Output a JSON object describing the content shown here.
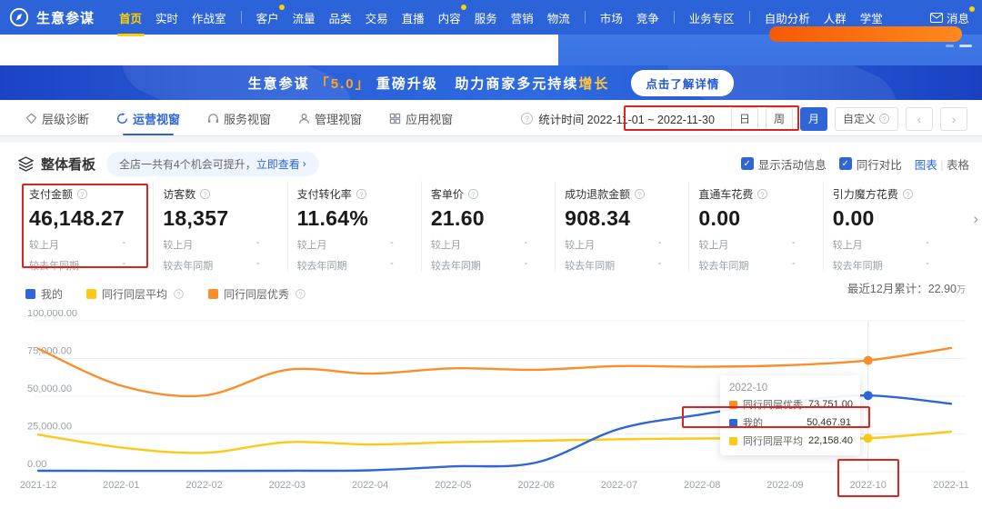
{
  "brand": {
    "name": "生意参谋"
  },
  "nav": {
    "items": [
      {
        "key": "home",
        "label": "首页",
        "active": true
      },
      {
        "key": "realtime",
        "label": "实时"
      },
      {
        "key": "war-room",
        "label": "作战室"
      },
      {
        "divider": true
      },
      {
        "key": "customer",
        "label": "客户",
        "badge": true
      },
      {
        "key": "traffic",
        "label": "流量"
      },
      {
        "key": "category",
        "label": "品类"
      },
      {
        "key": "trade",
        "label": "交易"
      },
      {
        "key": "live",
        "label": "直播"
      },
      {
        "key": "content",
        "label": "内容",
        "badge": true
      },
      {
        "key": "service",
        "label": "服务"
      },
      {
        "key": "marketing",
        "label": "营销"
      },
      {
        "key": "logistics",
        "label": "物流"
      },
      {
        "divider": true
      },
      {
        "key": "market",
        "label": "市场"
      },
      {
        "key": "competition",
        "label": "竞争"
      },
      {
        "divider": true
      },
      {
        "key": "business-zone",
        "label": "业务专区"
      },
      {
        "divider": true
      },
      {
        "key": "self-analysis",
        "label": "自助分析"
      },
      {
        "key": "audience",
        "label": "人群"
      },
      {
        "key": "academy",
        "label": "学堂"
      }
    ],
    "message": {
      "label": "消息",
      "badge": true
    }
  },
  "banner": {
    "prefix": "生意参谋",
    "version": "「5.0」",
    "title": "重磅升级",
    "subtitle": "助力商家多元持续",
    "highlight": "增长",
    "cta": "点击了解详情"
  },
  "tabs": [
    {
      "key": "level-diagnosis",
      "label": "层级诊断",
      "icon": "diamond-icon"
    },
    {
      "key": "operation-view",
      "label": "运营视窗",
      "icon": "refresh-icon",
      "active": true
    },
    {
      "key": "service-view",
      "label": "服务视窗",
      "icon": "headset-icon"
    },
    {
      "key": "management-view",
      "label": "管理视窗",
      "icon": "person-icon"
    },
    {
      "key": "app-view",
      "label": "应用视窗",
      "icon": "grid-icon"
    }
  ],
  "toolbar": {
    "stat_time": "统计时间 2022-11-01 ~ 2022-11-30",
    "range_buttons": [
      {
        "key": "day",
        "label": "日"
      },
      {
        "key": "week",
        "label": "周"
      },
      {
        "key": "month",
        "label": "月",
        "active": true
      },
      {
        "key": "custom",
        "label": "自定义",
        "info": true
      }
    ],
    "prev": "‹",
    "next": "›"
  },
  "kanban": {
    "title": "整体看板",
    "notice": "全店一共有4个机会可提升，",
    "notice_link": "立即查看",
    "notice_arrow": "›",
    "checkboxes": [
      {
        "key": "show-activity",
        "label": "显示活动信息",
        "checked": true
      },
      {
        "key": "peer-compare",
        "label": "同行对比",
        "checked": true
      }
    ],
    "view_chart": "图表",
    "view_sep": "|",
    "view_table": "表格"
  },
  "metrics": {
    "compare_labels": [
      "较上月",
      "较去年同期"
    ],
    "cards": [
      {
        "key": "payment-amount",
        "title": "支付金额",
        "value": "46,148.27",
        "compare_values": [
          "-",
          "-"
        ]
      },
      {
        "key": "visitors",
        "title": "访客数",
        "value": "18,357",
        "compare_values": [
          "-",
          "-"
        ]
      },
      {
        "key": "conversion-rate",
        "title": "支付转化率",
        "value": "11.64%",
        "compare_values": [
          "-",
          "-"
        ]
      },
      {
        "key": "avg-order-value",
        "title": "客单价",
        "value": "21.60",
        "compare_values": [
          "-",
          "-"
        ]
      },
      {
        "key": "refund-amount",
        "title": "成功退款金额",
        "value": "908.34",
        "compare_values": [
          "-",
          "-"
        ]
      },
      {
        "key": "express-train-cost",
        "title": "直通车花费",
        "value": "0.00",
        "compare_values": [
          "-",
          "-"
        ]
      },
      {
        "key": "gravity-cube-cost",
        "title": "引力魔方花费",
        "value": "0.00",
        "compare_values": [
          "-",
          "-"
        ]
      }
    ],
    "next_arrow": "›"
  },
  "legend": [
    {
      "key": "mine",
      "label": "我的",
      "color": "#2e65d9"
    },
    {
      "key": "peer-average",
      "label": "同行同层平均",
      "color": "#fbc916",
      "info": true
    },
    {
      "key": "peer-excellent",
      "label": "同行同层优秀",
      "color": "#f98e2b",
      "info": true
    }
  ],
  "cumulative": {
    "label": "最近12月累计：",
    "value": "22.90",
    "unit": "万"
  },
  "chart_data": {
    "type": "line",
    "title": "",
    "x": [
      "2021-12",
      "2022-01",
      "2022-02",
      "2022-03",
      "2022-04",
      "2022-05",
      "2022-06",
      "2022-07",
      "2022-08",
      "2022-09",
      "2022-10",
      "2022-11"
    ],
    "series": [
      {
        "name": "我的",
        "color": "#2e65d9",
        "values": [
          600,
          500,
          500,
          600,
          900,
          3500,
          6000,
          28300,
          38000,
          46000,
          50467.91,
          45000
        ]
      },
      {
        "name": "同行同层平均",
        "color": "#fbc916",
        "values": [
          24500,
          16000,
          12500,
          19500,
          18000,
          19500,
          20500,
          21500,
          22000,
          22200,
          22158.4,
          26500
        ]
      },
      {
        "name": "同行同层优秀",
        "color": "#f98e2b",
        "values": [
          81500,
          57000,
          50500,
          67500,
          65000,
          68500,
          67500,
          70000,
          69500,
          70500,
          73751.0,
          82000
        ]
      }
    ],
    "ylim": [
      0,
      100000
    ],
    "yticks": [
      {
        "v": 0,
        "label": "0.00"
      },
      {
        "v": 25000,
        "label": "25,000.00"
      },
      {
        "v": 50000,
        "label": "50,000.00"
      },
      {
        "v": 75000,
        "label": "75,000.00"
      },
      {
        "v": 100000,
        "label": "100,000.00"
      }
    ],
    "grid": true,
    "legend_position": "top-left",
    "highlight_index": 10
  },
  "tooltip": {
    "title": "2022-10",
    "rows": [
      {
        "name": "同行同层优秀",
        "value": "73,751.00",
        "color": "#f98e2b"
      },
      {
        "name": "我的",
        "value": "50,467.91",
        "color": "#2e65d9"
      },
      {
        "name": "同行同层平均",
        "value": "22,158.40",
        "color": "#fbc916"
      }
    ]
  }
}
